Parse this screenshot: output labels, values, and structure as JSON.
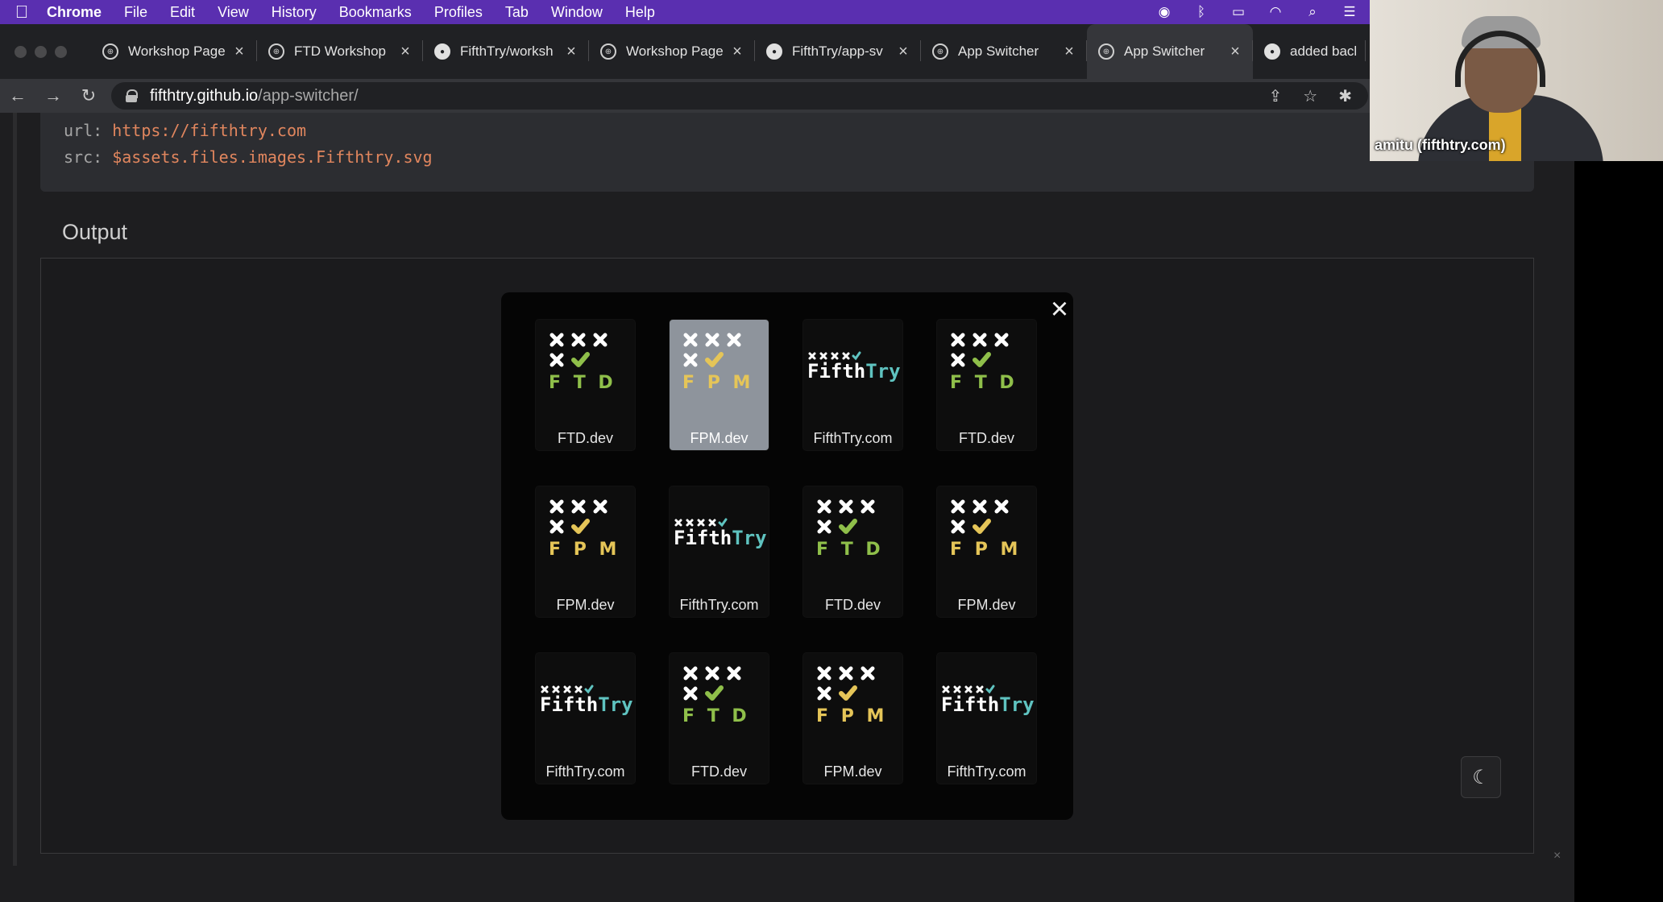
{
  "menubar": {
    "items": [
      "Chrome",
      "File",
      "Edit",
      "View",
      "History",
      "Bookmarks",
      "Profiles",
      "Tab",
      "Window",
      "Help"
    ]
  },
  "tabs": [
    {
      "title": "Workshop Page",
      "icon": "globe-icon"
    },
    {
      "title": "FTD Workshop",
      "icon": "globe-icon"
    },
    {
      "title": "FifthTry/worksh",
      "icon": "github-icon"
    },
    {
      "title": "Workshop Page",
      "icon": "globe-icon"
    },
    {
      "title": "FifthTry/app-sv",
      "icon": "github-icon"
    },
    {
      "title": "App Switcher",
      "icon": "globe-icon"
    },
    {
      "title": "App Switcher",
      "icon": "globe-icon",
      "active": true
    },
    {
      "title": "added back",
      "icon": "github-icon"
    }
  ],
  "address": {
    "host": "fifthtry.github.io",
    "path": "/app-switcher/"
  },
  "code": {
    "line1_key": "url:",
    "line1_val": "https://fifthtry.com",
    "line2_key": "src:",
    "line2_val": "$assets.files.images.Fifthtry.svg"
  },
  "output_label": "Output",
  "modal": {
    "close_glyph": "×",
    "apps": [
      {
        "label": "FTD.dev",
        "logo": "ftd",
        "selected": false
      },
      {
        "label": "FPM.dev",
        "logo": "fpm",
        "selected": true
      },
      {
        "label": "FifthTry.com",
        "logo": "fifthtry",
        "selected": false
      },
      {
        "label": "FTD.dev",
        "logo": "ftd",
        "selected": false
      },
      {
        "label": "FPM.dev",
        "logo": "fpm",
        "selected": false
      },
      {
        "label": "FifthTry.com",
        "logo": "fifthtry",
        "selected": false
      },
      {
        "label": "FTD.dev",
        "logo": "ftd",
        "selected": false
      },
      {
        "label": "FPM.dev",
        "logo": "fpm",
        "selected": false
      },
      {
        "label": "FifthTry.com",
        "logo": "fifthtry",
        "selected": false
      },
      {
        "label": "FTD.dev",
        "logo": "ftd",
        "selected": false
      },
      {
        "label": "FPM.dev",
        "logo": "fpm",
        "selected": false
      },
      {
        "label": "FifthTry.com",
        "logo": "fifthtry",
        "selected": false
      }
    ]
  },
  "logos": {
    "ftd_letters": "F T D",
    "fpm_letters": "F P M",
    "fifthtry_a": "Fifth",
    "fifthtry_b": "Try"
  },
  "colors": {
    "menubar": "#5a2fb0",
    "ftd_green": "#8fbf4a",
    "fpm_yellow": "#e5c558",
    "fifthtry_teal": "#5fc3c0"
  },
  "webcam": {
    "name": "amitu (fifthtry.com)"
  }
}
